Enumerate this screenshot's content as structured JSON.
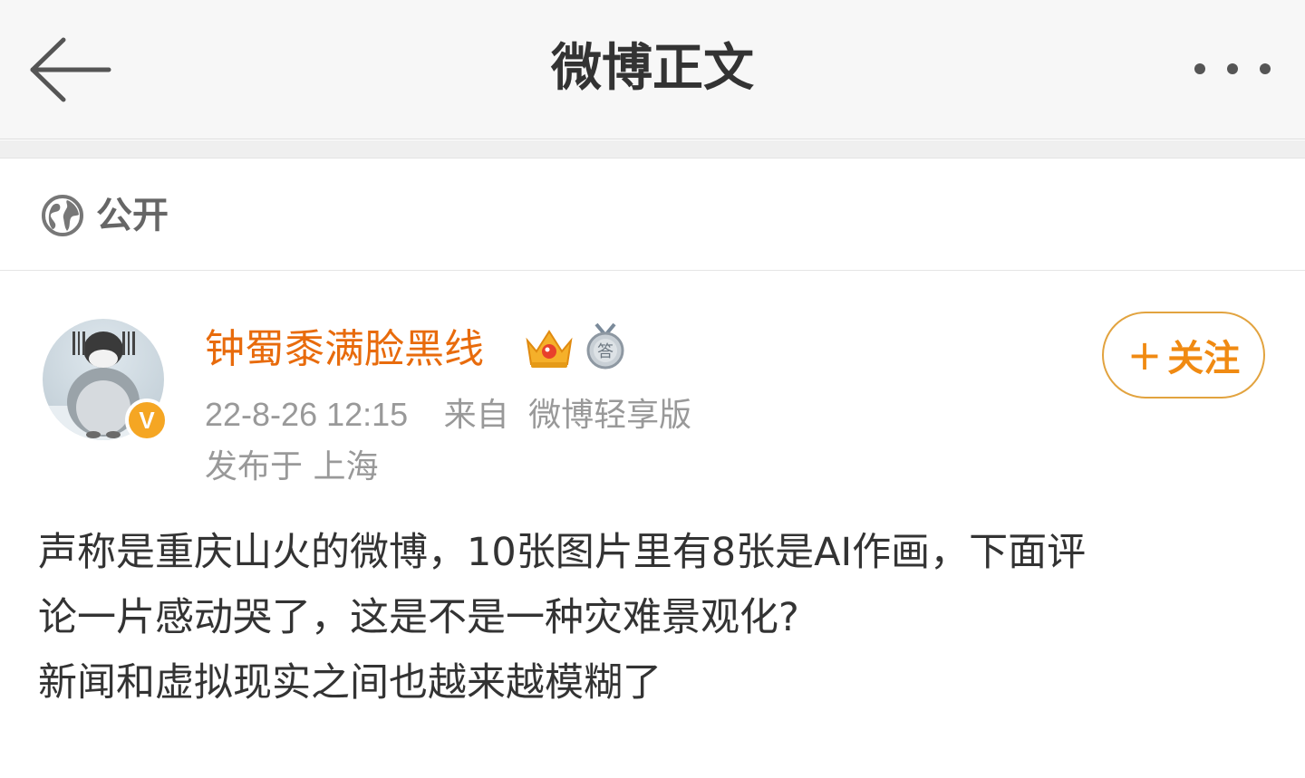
{
  "header": {
    "title": "微博正文",
    "back_icon": "arrow-left-icon",
    "more_icon": "more-dots-icon"
  },
  "visibility": {
    "icon": "globe-icon",
    "label": "公开"
  },
  "post": {
    "author": {
      "name": "钟蜀黍满脸黑线",
      "avatar": "penguin-avatar",
      "verified_badge": "V",
      "badges": [
        "crown-icon",
        "medal-answer-icon"
      ]
    },
    "follow_button": {
      "plus": "+",
      "label": "关注"
    },
    "timestamp": "22-8-26 12:15",
    "source_prefix": "来自",
    "source": "微博轻享版",
    "location_prefix": "发布于",
    "location": "上海",
    "body_lines": [
      "声称是重庆山火的微博，10张图片里有8张是AI作画，下面评",
      "论一片感动哭了，这是不是一种灾难景观化?",
      "新闻和虚拟现实之间也越来越模糊了"
    ]
  },
  "colors": {
    "username": "#e86b0c",
    "follow_text": "#f08a12",
    "follow_border": "#e2a33f",
    "verified": "#f5a623",
    "body_text": "#333333",
    "meta_text": "#999999",
    "nav_bg": "#f7f7f7"
  }
}
